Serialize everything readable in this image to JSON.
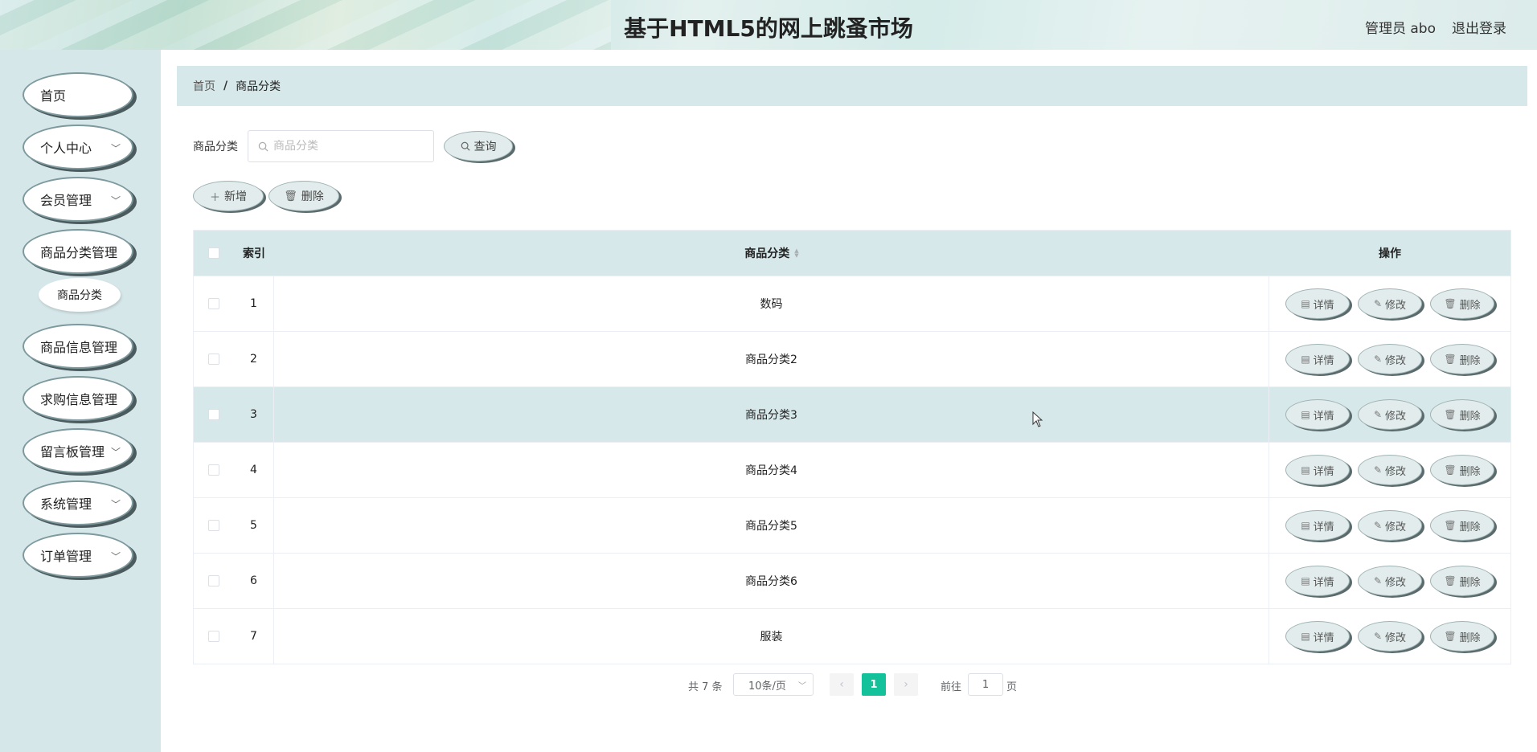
{
  "header": {
    "title": "基于HTML5的网上跳蚤市场",
    "user": "管理员 abo",
    "logout": "退出登录"
  },
  "sidebar": {
    "items": [
      {
        "label": "首页",
        "has_children": false
      },
      {
        "label": "个人中心",
        "has_children": true
      },
      {
        "label": "会员管理",
        "has_children": true
      },
      {
        "label": "商品分类管理",
        "has_children": false
      },
      {
        "label": "商品信息管理",
        "has_children": false
      },
      {
        "label": "求购信息管理",
        "has_children": false
      },
      {
        "label": "留言板管理",
        "has_children": true
      },
      {
        "label": "系统管理",
        "has_children": true
      },
      {
        "label": "订单管理",
        "has_children": true
      }
    ],
    "submenu": {
      "label": "商品分类",
      "active": true
    }
  },
  "breadcrumb": {
    "home": "首页",
    "separator": "/",
    "current": "商品分类"
  },
  "search": {
    "label": "商品分类",
    "placeholder": "商品分类",
    "value": "",
    "button": "查询"
  },
  "toolbar": {
    "add": "新增",
    "delete": "删除"
  },
  "table": {
    "columns": {
      "index": "索引",
      "category": "商品分类",
      "actions": "操作"
    },
    "rows": [
      {
        "index": "1",
        "category": "数码"
      },
      {
        "index": "2",
        "category": "商品分类2"
      },
      {
        "index": "3",
        "category": "商品分类3"
      },
      {
        "index": "4",
        "category": "商品分类4"
      },
      {
        "index": "5",
        "category": "商品分类5"
      },
      {
        "index": "6",
        "category": "商品分类6"
      },
      {
        "index": "7",
        "category": "服装"
      }
    ],
    "hovered_row": 2,
    "row_actions": {
      "detail": "详情",
      "edit": "修改",
      "delete": "删除"
    }
  },
  "pagination": {
    "total": "共 7 条",
    "page_size": "10条/页",
    "current_page": "1",
    "goto_label": "前往",
    "goto_value": "1",
    "page_suffix": "页"
  },
  "colors": {
    "accent": "#13c29b",
    "panel": "#d7e8ea",
    "sidebar": "#d6e7ea"
  }
}
